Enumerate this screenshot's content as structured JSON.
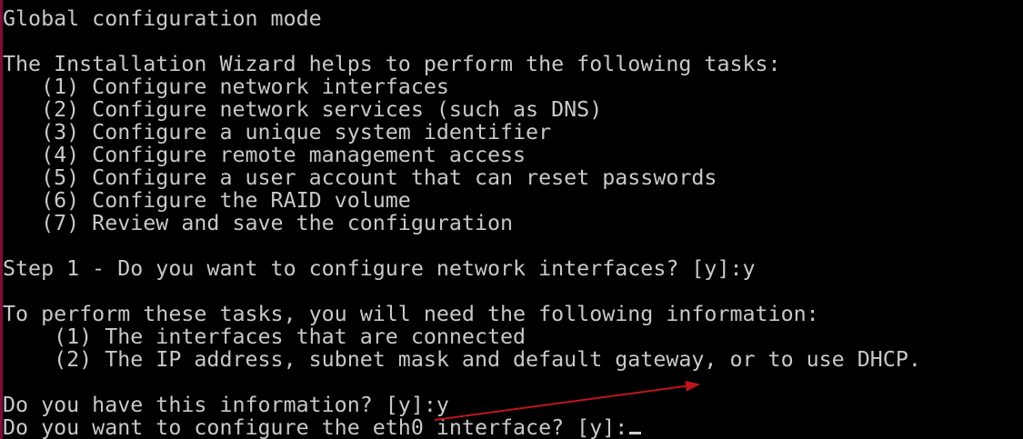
{
  "terminal": {
    "lines": [
      "Global configuration mode",
      "",
      "The Installation Wizard helps to perform the following tasks:",
      "   (1) Configure network interfaces",
      "   (2) Configure network services (such as DNS)",
      "   (3) Configure a unique system identifier",
      "   (4) Configure remote management access",
      "   (5) Configure a user account that can reset passwords",
      "   (6) Configure the RAID volume",
      "   (7) Review and save the configuration",
      "",
      "Step 1 - Do you want to configure network interfaces? [y]:y",
      "",
      "To perform these tasks, you will need the following information:",
      "    (1) The interfaces that are connected",
      "    (2) The IP address, subnet mask and default gateway, or to use DHCP.",
      "",
      "Do you have this information? [y]:y"
    ],
    "prompt": "Do you want to configure the eth0 interface? [y]:",
    "text_color": "#c8c8c8",
    "background_color": "#000000",
    "frame_color": "#7a0f3a"
  },
  "annotation": {
    "arrow_color": "#c0151c",
    "icon": "red-arrow-icon"
  }
}
